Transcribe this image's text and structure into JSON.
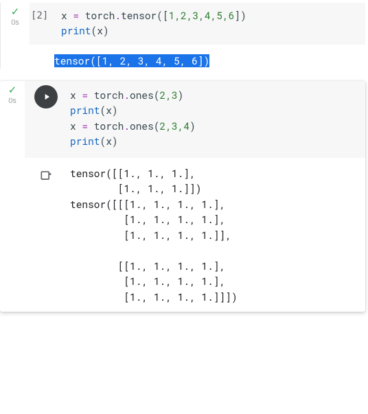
{
  "cells": [
    {
      "status_icon": "check",
      "elapsed": "0s",
      "exec_label": "[2]",
      "code": {
        "line1_pre": "x ",
        "line1_op": "=",
        "line1_mid": " torch",
        "line1_dot": ".",
        "line1_fn": "tensor",
        "line1_open": "([",
        "line1_nums": "1,2,3,4,5,6",
        "line1_close": "])",
        "line2_fn": "print",
        "line2_arg": "(x)"
      },
      "output_selected": "tensor([1, 2, 3, 4, 5, 6])"
    },
    {
      "status_icon": "check",
      "elapsed": "0s",
      "run": true,
      "code": {
        "l1a": "x ",
        "l1op": "=",
        "l1b": " torch",
        "l1d": ".",
        "l1fn": "ones",
        "l1args": "(",
        "l1n": "2,3",
        "l1c": ")",
        "l2fn": "print",
        "l2a": "(x)",
        "l3a": "x ",
        "l3op": "=",
        "l3b": " torch",
        "l3d": ".",
        "l3fn": "ones",
        "l3args": "(",
        "l3n": "2,3,4",
        "l3c": ")",
        "l4fn": "print",
        "l4a": "(x)"
      },
      "output": "tensor([[1., 1., 1.],\n        [1., 1., 1.]])\ntensor([[[1., 1., 1., 1.],\n         [1., 1., 1., 1.],\n         [1., 1., 1., 1.]],\n\n        [[1., 1., 1., 1.],\n         [1., 1., 1., 1.],\n         [1., 1., 1., 1.]]])"
    }
  ]
}
